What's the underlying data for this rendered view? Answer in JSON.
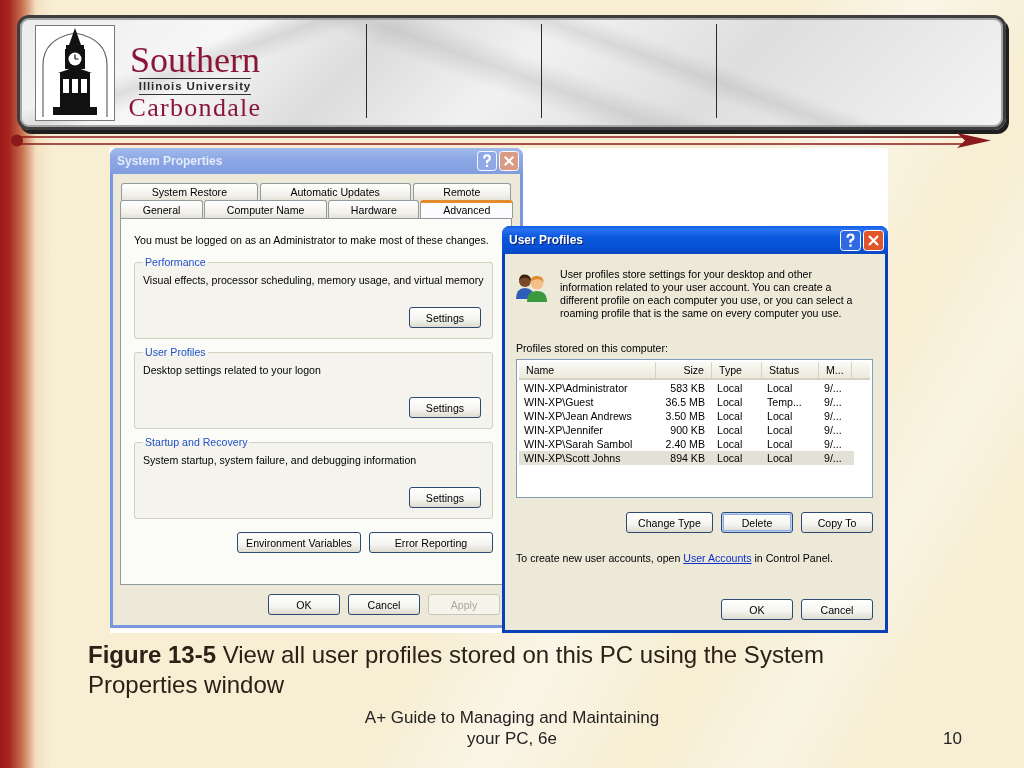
{
  "header": {
    "logo": {
      "line1": "Southern",
      "line2": "Illinois University",
      "line3": "Carbondale"
    }
  },
  "figure": {
    "system_properties": {
      "title": "System Properties",
      "active": false,
      "tab_rows": [
        [
          {
            "label": "System Restore",
            "selected": false
          },
          {
            "label": "Automatic Updates",
            "selected": false
          },
          {
            "label": "Remote",
            "selected": false
          }
        ],
        [
          {
            "label": "General",
            "selected": false
          },
          {
            "label": "Computer Name",
            "selected": false
          },
          {
            "label": "Hardware",
            "selected": false
          },
          {
            "label": "Advanced",
            "selected": true
          }
        ]
      ],
      "note": "You must be logged on as an Administrator to make most of these changes.",
      "groups": [
        {
          "title": "Performance",
          "text": "Visual effects, processor scheduling, memory usage, and virtual memory",
          "button": "Settings"
        },
        {
          "title": "User Profiles",
          "text": "Desktop settings related to your logon",
          "button": "Settings"
        },
        {
          "title": "Startup and Recovery",
          "text": "System startup, system failure, and debugging information",
          "button": "Settings"
        }
      ],
      "panel_buttons": [
        "Environment Variables",
        "Error Reporting"
      ],
      "buttons": [
        {
          "label": "OK",
          "disabled": false
        },
        {
          "label": "Cancel",
          "disabled": false
        },
        {
          "label": "Apply",
          "disabled": true
        }
      ]
    },
    "user_profiles": {
      "title": "User Profiles",
      "active": true,
      "intro": "User profiles store settings for your desktop and other\ninformation related to your user account. You can create a\ndifferent profile on each computer you use, or you can select a\nroaming profile that is the same on every computer you use.",
      "list_label": "Profiles stored on this computer:",
      "columns": [
        "Name",
        "Size",
        "Type",
        "Status",
        "M..."
      ],
      "rows": [
        {
          "cells": [
            "WIN-XP\\Administrator",
            "583 KB",
            "Local",
            "Local",
            "9/..."
          ],
          "selected": false
        },
        {
          "cells": [
            "WIN-XP\\Guest",
            "36.5 MB",
            "Local",
            "Temp...",
            "9/..."
          ],
          "selected": false
        },
        {
          "cells": [
            "WIN-XP\\Jean Andrews",
            "3.50 MB",
            "Local",
            "Local",
            "9/..."
          ],
          "selected": false
        },
        {
          "cells": [
            "WIN-XP\\Jennifer",
            "900 KB",
            "Local",
            "Local",
            "9/..."
          ],
          "selected": false
        },
        {
          "cells": [
            "WIN-XP\\Sarah Sambol",
            "2.40 MB",
            "Local",
            "Local",
            "9/..."
          ],
          "selected": false
        },
        {
          "cells": [
            "WIN-XP\\Scott Johns",
            "894 KB",
            "Local",
            "Local",
            "9/..."
          ],
          "selected": true
        }
      ],
      "action_buttons": [
        {
          "label": "Change Type",
          "focused": false
        },
        {
          "label": "Delete",
          "focused": true
        },
        {
          "label": "Copy To",
          "focused": false
        }
      ],
      "note": {
        "before": "To create new user accounts, open",
        "link": "User Accounts",
        "after": "in Control Panel."
      },
      "buttons": [
        "OK",
        "Cancel"
      ]
    }
  },
  "caption": "**Figure 13-5** View all user profiles stored on this PC using the System Properties window",
  "footer": {
    "title": "A+ Guide to Managing and Maintaining\nyour PC, 6e",
    "page": "10"
  }
}
